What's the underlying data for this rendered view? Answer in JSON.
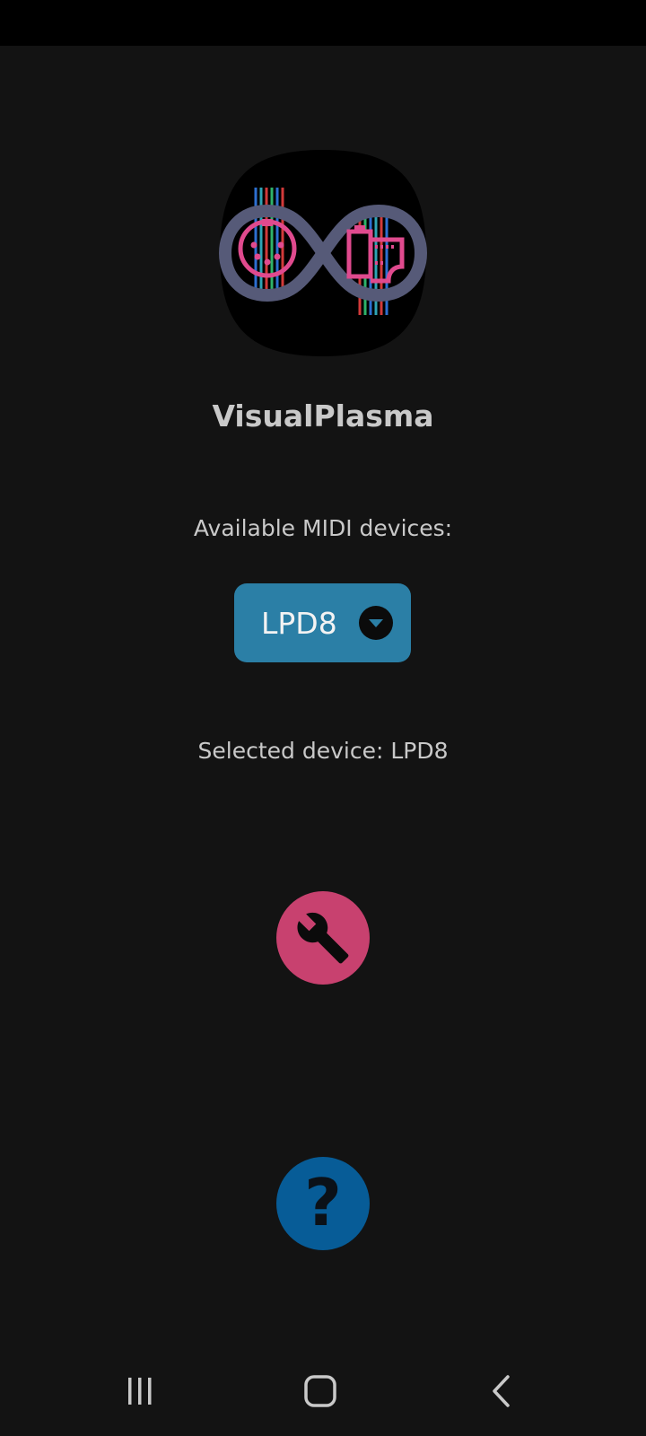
{
  "app": {
    "title": "VisualPlasma"
  },
  "midi": {
    "available_label": "Available MIDI devices:",
    "selected_device_value": "LPD8",
    "selected_device_text": "Selected device: LPD8"
  },
  "actions": {
    "settings_icon": "wrench-icon",
    "help_icon": "question-icon",
    "help_glyph": "?"
  },
  "nav": {
    "recents_icon": "recents-icon",
    "home_icon": "home-icon",
    "back_icon": "back-icon"
  },
  "colors": {
    "background": "#131313",
    "status_bar": "#000000",
    "dropdown": "#2b7fa6",
    "settings_fab": "#c8416f",
    "help_fab": "#075c97",
    "text": "#c9c9c9"
  }
}
